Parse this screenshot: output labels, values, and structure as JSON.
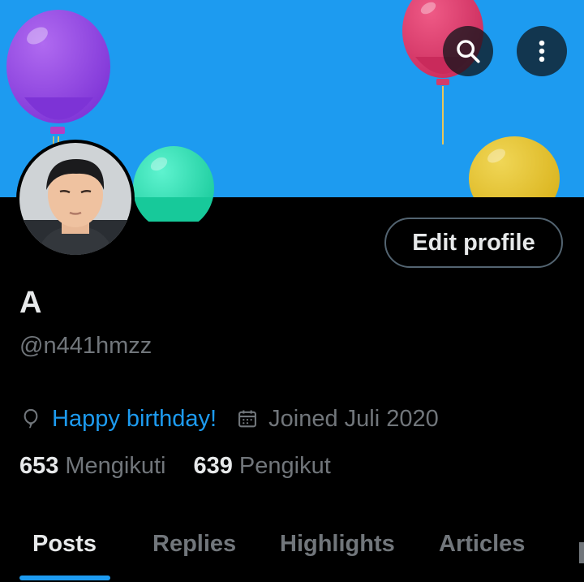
{
  "header": {
    "search_icon": "search-icon",
    "more_icon": "more-vertical-icon"
  },
  "profile": {
    "display_name": "A",
    "handle": "@n441hmzz",
    "edit_button_label": "Edit profile",
    "birthday_text": "Happy birthday!",
    "joined_text": "Joined Juli 2020",
    "following_count": "653",
    "following_label": "Mengikuti",
    "followers_count": "639",
    "followers_label": "Pengikut"
  },
  "tabs": [
    {
      "label": "Posts",
      "active": true
    },
    {
      "label": "Replies",
      "active": false
    },
    {
      "label": "Highlights",
      "active": false
    },
    {
      "label": "Articles",
      "active": false
    }
  ],
  "colors": {
    "banner": "#1d9bf0",
    "accent": "#1d9bf0",
    "background": "#000000",
    "muted_text": "#71767b"
  }
}
